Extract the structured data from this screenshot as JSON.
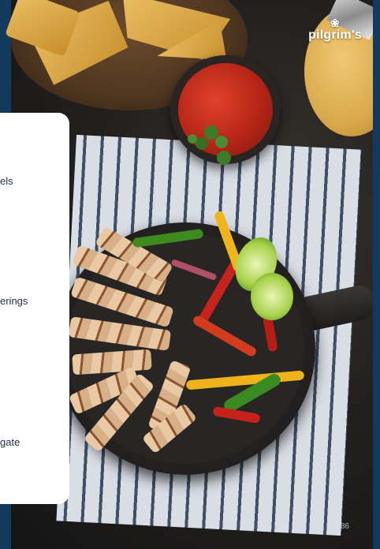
{
  "brand": {
    "name": "pilgrim's"
  },
  "side_panel": {
    "items": [
      {
        "label": "els"
      },
      {
        "label": "erings"
      },
      {
        "label": "gate"
      }
    ]
  },
  "footer": {
    "page_number": "86"
  },
  "colors": {
    "accent_bar": "#123a5e",
    "panel_bg": "#ffffff",
    "panel_text": "#1f2d46"
  }
}
